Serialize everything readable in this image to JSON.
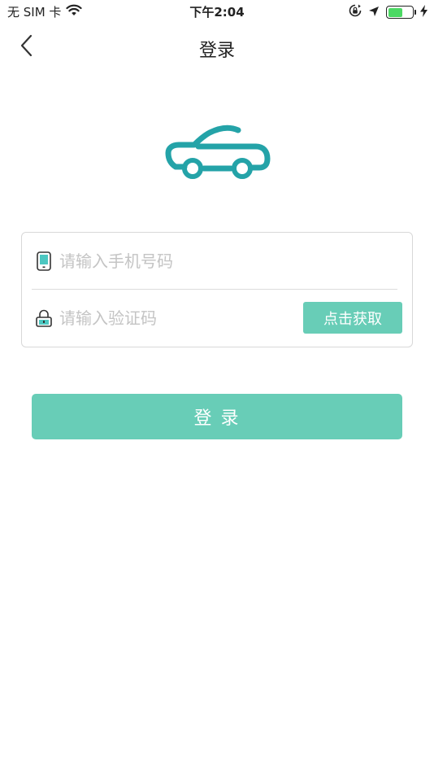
{
  "status_bar": {
    "carrier": "无 SIM 卡",
    "time": "下午2:04",
    "battery_level": 0.6,
    "battery_color": "#4cd964"
  },
  "nav": {
    "title": "登录",
    "back_icon": "chevron-left-icon"
  },
  "logo": {
    "icon": "car-icon",
    "color": "#24a3a8"
  },
  "form": {
    "phone": {
      "placeholder": "请输入手机号码",
      "value": "",
      "icon": "phone-icon"
    },
    "code": {
      "placeholder": "请输入验证码",
      "value": "",
      "icon": "lock-icon"
    },
    "get_code_label": "点击获取"
  },
  "login_button": {
    "label": "登 录"
  },
  "colors": {
    "accent": "#68cdb7",
    "logo": "#24a3a8"
  }
}
